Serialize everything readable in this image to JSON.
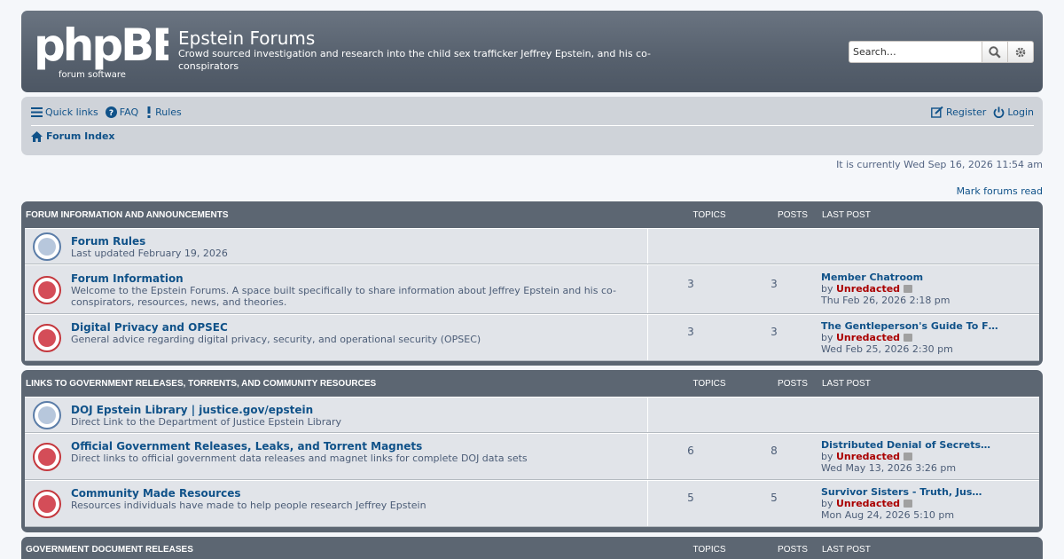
{
  "header": {
    "logo_text": "phpBB",
    "logo_sub": "forum software",
    "site_title": "Epstein Forums",
    "site_description": "Crowd sourced investigation and research into the child sex trafficker Jeffrey Epstein, and his co-conspirators",
    "search_placeholder": "Search…"
  },
  "nav": {
    "quick_links": "Quick links",
    "faq": "FAQ",
    "rules": "Rules",
    "register": "Register",
    "login": "Login",
    "forum_index": "Forum Index"
  },
  "current_time": "It is currently Wed Sep 16, 2026 11:54 am",
  "mark_read": "Mark forums read",
  "columns": {
    "topics": "TOPICS",
    "posts": "POSTS",
    "last_post": "LAST POST"
  },
  "categories": [
    {
      "title": "FORUM INFORMATION AND ANNOUNCEMENTS",
      "forums": [
        {
          "title": "Forum Rules",
          "desc": "Last updated February 19, 2026",
          "icon": "link-icon"
        },
        {
          "title": "Forum Information",
          "desc": "Welcome to the Epstein Forums. A space built specifically to share information about Jeffrey Epstein and his co-conspirators, resources, news, and theories.",
          "icon": "lock-icon",
          "topics": "3",
          "posts": "3",
          "last_title": "Member Chatroom",
          "last_by": "by",
          "last_user": "Unredacted",
          "last_date": "Thu Feb 26, 2026 2:18 pm"
        },
        {
          "title": "Digital Privacy and OPSEC",
          "desc": "General advice regarding digital privacy, security, and operational security (OPSEC)",
          "icon": "lock-icon",
          "topics": "3",
          "posts": "3",
          "last_title": "The Gentleperson's Guide To F…",
          "last_by": "by",
          "last_user": "Unredacted",
          "last_date": "Wed Feb 25, 2026 2:30 pm"
        }
      ]
    },
    {
      "title": "LINKS TO GOVERNMENT RELEASES, TORRENTS, AND COMMUNITY RESOURCES",
      "forums": [
        {
          "title": "DOJ Epstein Library | justice.gov/epstein",
          "desc": "Direct Link to the Department of Justice Epstein Library",
          "icon": "link-icon"
        },
        {
          "title": "Official Government Releases, Leaks, and Torrent Magnets",
          "desc": "Direct links to official government data releases and magnet links for complete DOJ data sets",
          "icon": "lock-icon",
          "topics": "6",
          "posts": "8",
          "last_title": "Distributed Denial of Secrets…",
          "last_by": "by",
          "last_user": "Unredacted",
          "last_date": "Wed May 13, 2026 3:26 pm"
        },
        {
          "title": "Community Made Resources",
          "desc": "Resources individuals have made to help people research Jeffrey Epstein",
          "icon": "lock-icon",
          "topics": "5",
          "posts": "5",
          "last_title": "Survivor Sisters - Truth, Jus…",
          "last_by": "by",
          "last_user": "Unredacted",
          "last_date": "Mon Aug 24, 2026 5:10 pm"
        }
      ]
    },
    {
      "title": "GOVERNMENT DOCUMENT RELEASES"
    }
  ]
}
